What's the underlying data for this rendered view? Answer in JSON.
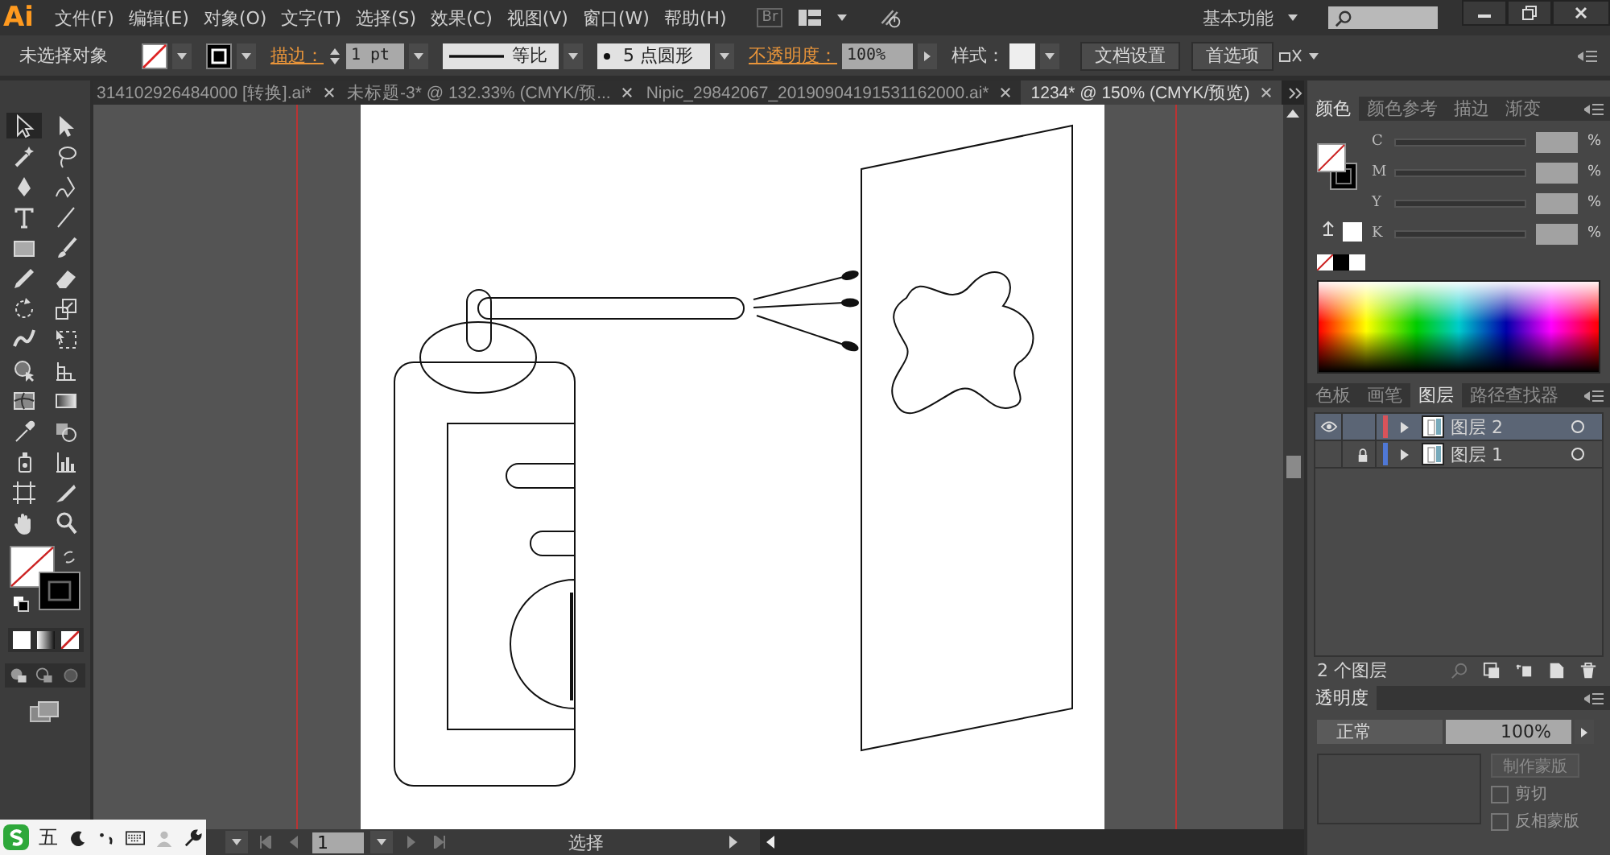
{
  "app": {
    "logo": "Ai",
    "bridge": "Br",
    "workspace": "基本功能"
  },
  "menu": [
    "文件(F)",
    "编辑(E)",
    "对象(O)",
    "文字(T)",
    "选择(S)",
    "效果(C)",
    "视图(V)",
    "窗口(W)",
    "帮助(H)"
  ],
  "control_bar": {
    "selection": "未选择对象",
    "stroke_label": "描边：",
    "stroke_weight": "1 pt",
    "profile": "等比",
    "brush": "5 点圆形",
    "opacity_label": "不透明度：",
    "opacity": "100%",
    "style_label": "样式：",
    "buttons": [
      "文档设置",
      "首选项"
    ]
  },
  "tabs": [
    {
      "label": "314102926484000 [转换].ai*",
      "selected": false
    },
    {
      "label": "未标题-3* @ 132.33% (CMYK/预...",
      "selected": false
    },
    {
      "label": "Nipic_29842067_20190904191531162000.ai*",
      "selected": false
    },
    {
      "label": "1234* @ 150% (CMYK/预览)",
      "selected": true
    }
  ],
  "color_panel": {
    "tabs": [
      {
        "label": "颜色",
        "selected": true
      },
      {
        "label": "颜色参考",
        "selected": false
      },
      {
        "label": "描边",
        "selected": false
      },
      {
        "label": "渐变",
        "selected": false
      }
    ],
    "channels": [
      {
        "name": "C",
        "unit": "%"
      },
      {
        "name": "M",
        "unit": "%"
      },
      {
        "name": "Y",
        "unit": "%"
      },
      {
        "name": "K",
        "unit": "%"
      }
    ]
  },
  "layers_panel": {
    "tabs": [
      {
        "label": "色板",
        "selected": false
      },
      {
        "label": "画笔",
        "selected": false
      },
      {
        "label": "图层",
        "selected": true
      },
      {
        "label": "路径查找器",
        "selected": false
      }
    ],
    "layers": [
      {
        "name": "图层 2",
        "selected": true,
        "visible": true,
        "locked": false,
        "color": "#d9535a"
      },
      {
        "name": "图层 1",
        "selected": false,
        "visible": false,
        "locked": true,
        "color": "#4f78d6"
      }
    ],
    "count": "2 个图层"
  },
  "transparency_panel": {
    "title": "透明度",
    "mode": "正常",
    "opacity": "100%",
    "button": {
      "label": "制作蒙版",
      "disabled": true
    },
    "options": [
      {
        "label": "剪切",
        "checked": false
      },
      {
        "label": "反相蒙版",
        "checked": false
      }
    ]
  },
  "status_bar": {
    "page": "1",
    "tool": "选择"
  },
  "ime": {
    "mode": "五"
  }
}
